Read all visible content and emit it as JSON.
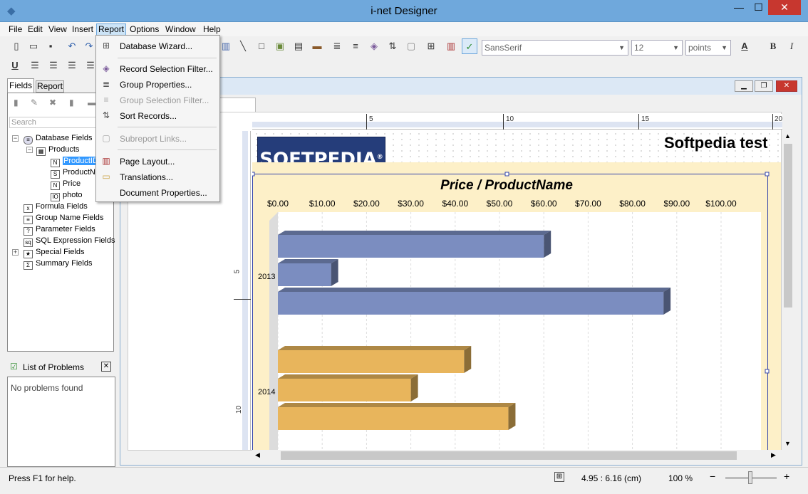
{
  "window": {
    "title": "i-net Designer",
    "min": "—",
    "max": "☐",
    "close": "✕"
  },
  "menu": [
    "File",
    "Edit",
    "View",
    "Insert",
    "Report",
    "Options",
    "Window",
    "Help"
  ],
  "format_toolbar": {
    "font": "SansSerif",
    "size": "12",
    "unit": "points",
    "bold": "B",
    "italic": "I",
    "underline": "U"
  },
  "left_panel": {
    "tabs": [
      "Fields",
      "Report"
    ],
    "search_placeholder": "Search",
    "tree": [
      "Database Fields",
      "Products",
      "ProductID",
      "ProductName",
      "Price",
      "photo",
      "Formula Fields",
      "Group Name Fields",
      "Parameter Fields",
      "SQL Expression Fields",
      "Special Fields",
      "Summary Fields"
    ]
  },
  "problems": {
    "title": "List of Problems",
    "message": "No problems found"
  },
  "report_menu": {
    "items": [
      {
        "label": "Database Wizard...",
        "enabled": true
      },
      {
        "label": "Record Selection Filter...",
        "enabled": true
      },
      {
        "label": "Group Properties...",
        "enabled": true
      },
      {
        "label": "Group Selection Filter...",
        "enabled": false
      },
      {
        "label": "Sort Records...",
        "enabled": true
      },
      {
        "label": "Subreport Links...",
        "enabled": false
      },
      {
        "label": "Page Layout...",
        "enabled": true
      },
      {
        "label": "Translations...",
        "enabled": true
      },
      {
        "label": "Document Properties...",
        "enabled": true
      }
    ]
  },
  "ruler": {
    "marks": [
      "5",
      "10",
      "15",
      "20"
    ],
    "vmarks": [
      "5",
      "10"
    ]
  },
  "report": {
    "logo": "SOFTPEDIA",
    "logo_mark": "®",
    "heading": "Softpedia test"
  },
  "chart_data": {
    "type": "bar",
    "orientation": "horizontal",
    "title": "Price / ProductName",
    "xlim": [
      0,
      110
    ],
    "ticks": [
      "$0.00",
      "$10.00",
      "$20.00",
      "$30.00",
      "$40.00",
      "$50.00",
      "$60.00",
      "$70.00",
      "$80.00",
      "$90.00",
      "$100.00"
    ],
    "tick_values": [
      0,
      10,
      20,
      30,
      40,
      50,
      60,
      70,
      80,
      90,
      100
    ],
    "groups": [
      {
        "category": "2013",
        "color": "#7b8dc0",
        "values": [
          60,
          12,
          87
        ]
      },
      {
        "category": "2014",
        "color": "#e8b55c",
        "values": [
          42,
          30,
          52
        ]
      }
    ]
  },
  "status": {
    "help": "Press F1 for help.",
    "coords": "4.95 : 6.16 (cm)",
    "zoom": "100 %"
  },
  "colors": {
    "titlebar": "#6fa8dc",
    "selection": "#3399ff",
    "band": "#fdf0c8"
  }
}
